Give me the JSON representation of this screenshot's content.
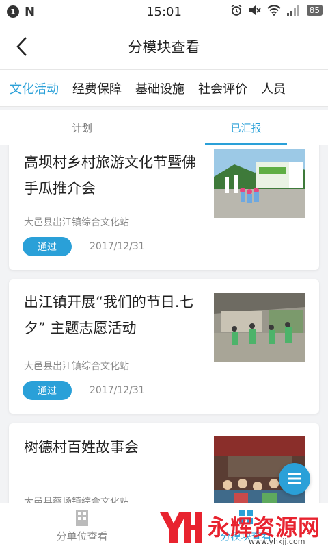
{
  "status_bar": {
    "notification_count": "1",
    "app_letter": "N",
    "time": "15:01",
    "battery": "85"
  },
  "header": {
    "title": "分模块查看"
  },
  "module_tabs": [
    {
      "label": "文化活动"
    },
    {
      "label": "经费保障"
    },
    {
      "label": "基础设施"
    },
    {
      "label": "社会评价"
    },
    {
      "label": "人员"
    }
  ],
  "sub_tabs": [
    {
      "label": "计划"
    },
    {
      "label": "已汇报"
    }
  ],
  "reports": [
    {
      "title": "高坝村乡村旅游文化节暨佛手瓜推介会",
      "org": "大邑县出江镇综合文化站",
      "status": "通过",
      "date": "2017/12/31"
    },
    {
      "title": "出江镇开展“我们的节日.七夕” 主题志愿活动",
      "org": "大邑县出江镇综合文化站",
      "status": "通过",
      "date": "2017/12/31"
    },
    {
      "title": "树德村百姓故事会",
      "org": "大邑县蔡场镇综合文化站"
    }
  ],
  "bottom_nav": [
    {
      "label": "分单位查看"
    },
    {
      "label": "分模块查看"
    }
  ],
  "watermark": {
    "text": "永辉资源网",
    "url": "www.yhkjj.com"
  },
  "colors": {
    "accent": "#2aa0d8",
    "watermark": "#e8232f"
  }
}
